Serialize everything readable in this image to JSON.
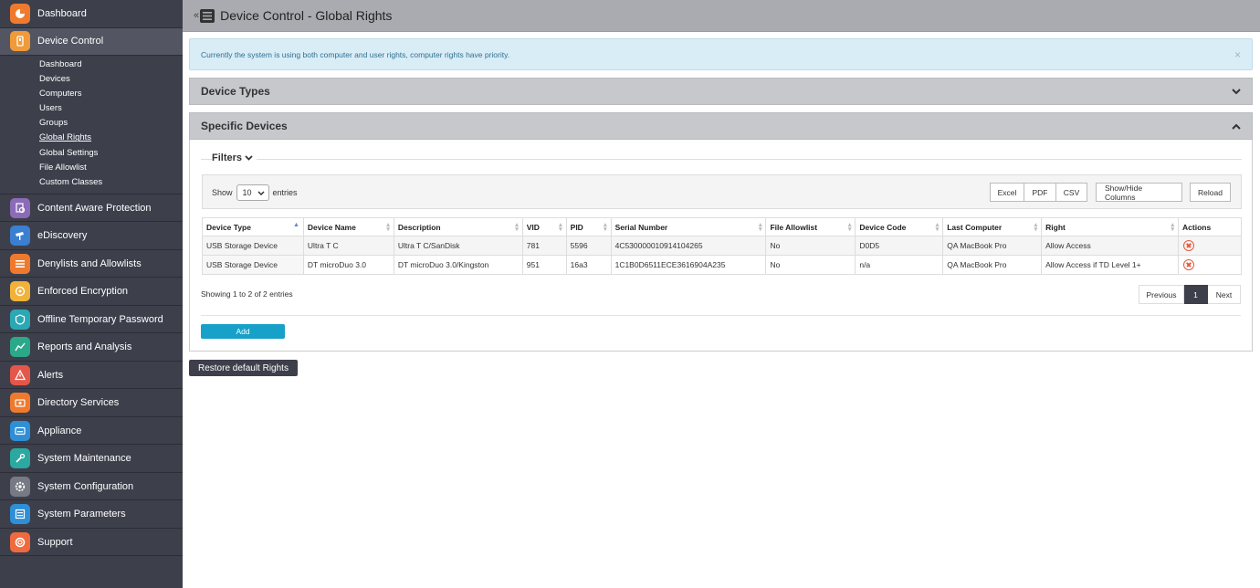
{
  "colors": {
    "sidebar_bg": "#3d3f4b",
    "header_bg": "#a9abb0",
    "accent": "#17a0c8",
    "alert_bg": "#d9edf7",
    "delete_red": "#e35a3e"
  },
  "sidebar": {
    "items": [
      {
        "label": "Dashboard",
        "icon": "dashboard-icon",
        "color": "#ef7a2e"
      },
      {
        "label": "Device Control",
        "icon": "device-control-icon",
        "color": "#f09a3a",
        "active": true
      },
      {
        "label": "Content Aware Protection",
        "icon": "content-aware-icon",
        "color": "#8b6bb8"
      },
      {
        "label": "eDiscovery",
        "icon": "ediscovery-icon",
        "color": "#3b7fd0"
      },
      {
        "label": "Denylists and Allowlists",
        "icon": "lists-icon",
        "color": "#ef7a2e"
      },
      {
        "label": "Enforced Encryption",
        "icon": "encryption-icon",
        "color": "#f0b23a"
      },
      {
        "label": "Offline Temporary Password",
        "icon": "temp-password-icon",
        "color": "#2ba8b4"
      },
      {
        "label": "Reports and Analysis",
        "icon": "reports-icon",
        "color": "#2ba88a"
      },
      {
        "label": "Alerts",
        "icon": "alerts-icon",
        "color": "#e5564a"
      },
      {
        "label": "Directory Services",
        "icon": "directory-icon",
        "color": "#ef7a2e"
      },
      {
        "label": "Appliance",
        "icon": "appliance-icon",
        "color": "#2e8fd6"
      },
      {
        "label": "System Maintenance",
        "icon": "maintenance-icon",
        "color": "#2ba8a0"
      },
      {
        "label": "System Configuration",
        "icon": "configuration-icon",
        "color": "#777a85"
      },
      {
        "label": "System Parameters",
        "icon": "parameters-icon",
        "color": "#2e8fd6"
      },
      {
        "label": "Support",
        "icon": "support-icon",
        "color": "#ef6a3e"
      }
    ],
    "sub_items": [
      "Dashboard",
      "Devices",
      "Computers",
      "Users",
      "Groups",
      "Global Rights",
      "Global Settings",
      "File Allowlist",
      "Custom Classes"
    ],
    "current_sub": "Global Rights"
  },
  "header": {
    "title": "Device Control - Global Rights",
    "collapse_glyph": "«"
  },
  "alert": {
    "text": "Currently the system is using both computer and user rights, computer rights have priority.",
    "close": "×"
  },
  "panels": {
    "device_types": {
      "title": "Device Types",
      "chevron": "⌄"
    },
    "specific_devices": {
      "title": "Specific Devices",
      "chevron": "⌃"
    }
  },
  "filters": {
    "label": "Filters"
  },
  "toolbar": {
    "show_label": "Show",
    "entries_value": "10",
    "entries_label": "entries",
    "excel": "Excel",
    "pdf": "PDF",
    "csv": "CSV",
    "show_hide": "Show/Hide Columns",
    "reload": "Reload"
  },
  "table": {
    "columns": [
      "Device Type",
      "Device Name",
      "Description",
      "VID",
      "PID",
      "Serial Number",
      "File Allowlist",
      "Device Code",
      "Last Computer",
      "Right",
      "Actions"
    ],
    "rows": [
      [
        "USB Storage Device",
        "Ultra T C",
        "Ultra T C/SanDisk",
        "781",
        "5596",
        "4C530000010914104265",
        "No",
        "D0D5",
        "QA MacBook Pro",
        "Allow Access"
      ],
      [
        "USB Storage Device",
        "DT microDuo 3.0",
        "DT microDuo 3.0/Kingston",
        "951",
        "16a3",
        "1C1B0D6511ECE3616904A235",
        "No",
        "n/a",
        "QA MacBook Pro",
        "Allow Access if TD Level 1+"
      ]
    ]
  },
  "footer": {
    "info": "Showing 1 to 2 of 2 entries",
    "previous": "Previous",
    "page": "1",
    "next": "Next"
  },
  "buttons": {
    "add": "Add",
    "restore": "Restore default Rights"
  }
}
